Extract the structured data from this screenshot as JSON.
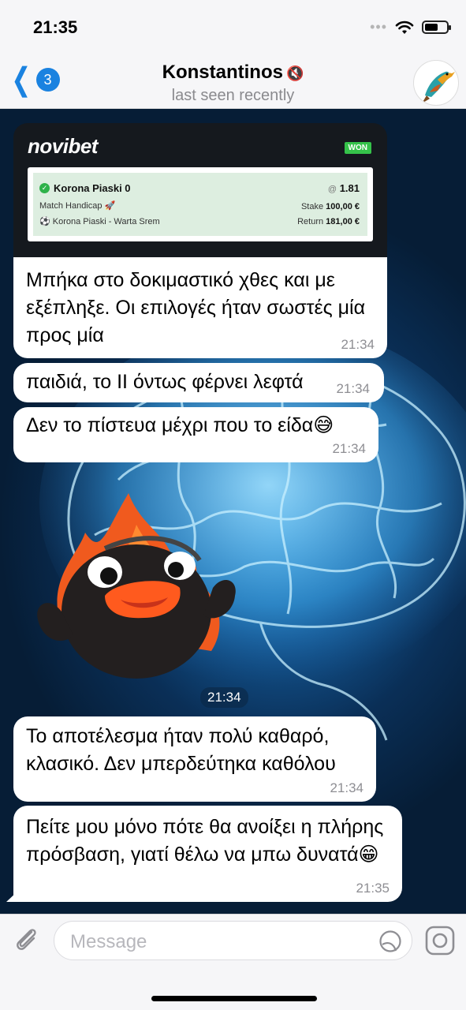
{
  "status_bar": {
    "time": "21:35",
    "signal_dots": "•••"
  },
  "header": {
    "back_count": "3",
    "title": "Konstantinos",
    "subtitle": "last seen recently"
  },
  "bet_card": {
    "brand": "novibet",
    "badge": "WON",
    "selection": "Korona Piaski 0",
    "odds_prefix": "@",
    "odds": "1.81",
    "market": "Match Handicap 🚀",
    "event": "Korona Piaski - Warta Srem",
    "stake_label": "Stake",
    "stake_value": "100,00 €",
    "return_label": "Return",
    "return_value": "181,00 €"
  },
  "messages": [
    {
      "text": "Μπήκα στο δοκιμαστικό χθες και με εξέπληξε. Οι επιλογές ήταν σωστές μία προς μία",
      "time": "21:34"
    },
    {
      "text": "παιδιά, το ΙΙ όντως φέρνει λεφτά",
      "time": "21:34"
    },
    {
      "text": "Δεν το πίστευα μέχρι που το είδα😅",
      "time": "21:34"
    },
    {
      "text": "Το αποτέλεσμα ήταν πολύ καθαρό, κλασικό. Δεν μπερδεύτηκα καθόλου",
      "time": "21:34"
    },
    {
      "text": "Πείτε μου μόνο πότε θα ανοίξει η πλήρης πρόσβαση, γιατί θέλω να μπω δυνατά😁",
      "time": "21:35"
    }
  ],
  "sticker": {
    "time": "21:34"
  },
  "input": {
    "placeholder": "Message"
  },
  "colors": {
    "accent": "#1a82e0",
    "won_badge": "#35c24a",
    "card_bg": "#15191e",
    "bet_bg": "#ddeee0"
  }
}
